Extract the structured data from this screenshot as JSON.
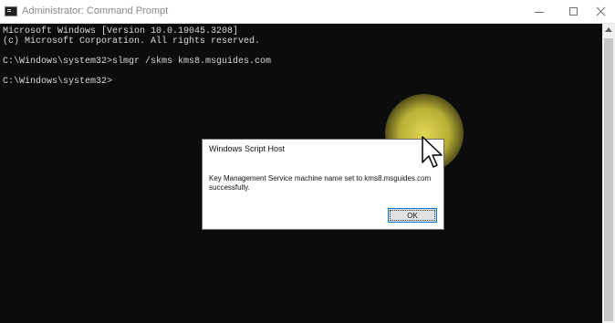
{
  "window": {
    "title": "Administrator: Command Prompt",
    "icon": "cmd-icon"
  },
  "console": {
    "lines": [
      "Microsoft Windows [Version 10.0.19045.3208]",
      "(c) Microsoft Corporation. All rights reserved.",
      "",
      "C:\\Windows\\system32>slmgr /skms kms8.msguides.com",
      "",
      "C:\\Windows\\system32>"
    ]
  },
  "dialog": {
    "title": "Windows Script Host",
    "message": "Key Management Service machine name set to kms8.msguides.com successfully.",
    "ok_label": "OK"
  },
  "colors": {
    "console_bg": "#0c0c0c",
    "console_text": "#d9d9d9",
    "cursor_highlight": "#e6dc55",
    "button_focus": "#0078d7"
  }
}
